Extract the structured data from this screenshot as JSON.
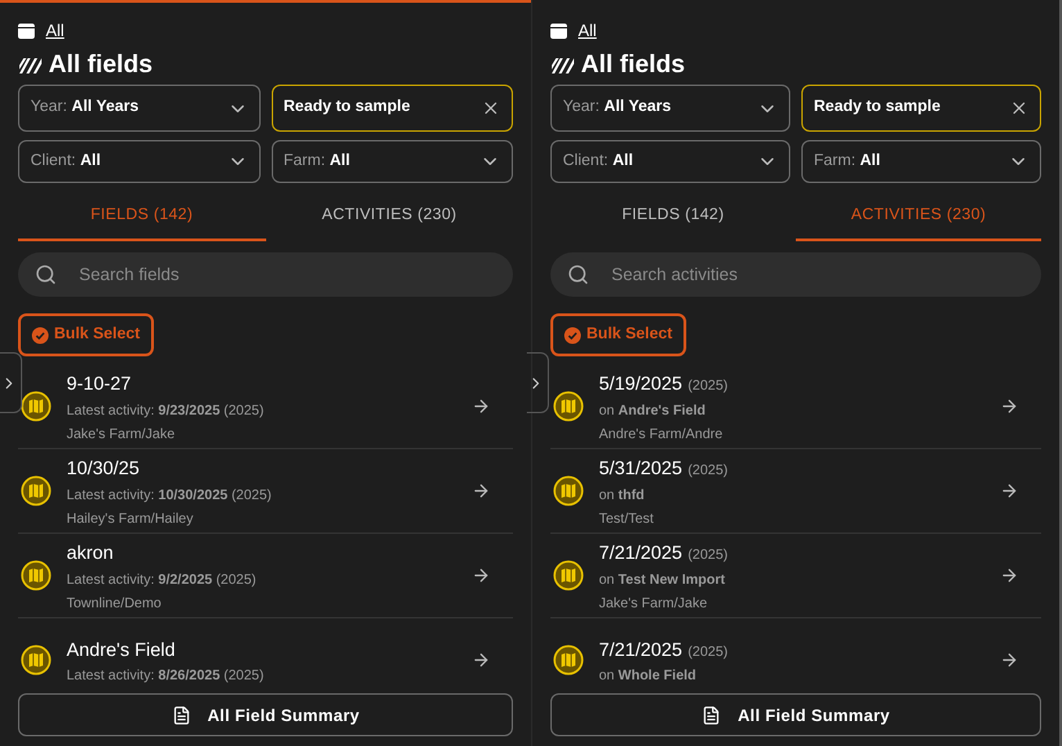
{
  "panels": [
    {
      "top_accent": true,
      "breadcrumb": "All",
      "title": "All fields",
      "filters": [
        {
          "kind": "select",
          "label": "Year:",
          "value": "All Years"
        },
        {
          "kind": "chip",
          "value": "Ready to sample"
        },
        {
          "kind": "select",
          "label": "Client:",
          "value": "All"
        },
        {
          "kind": "select",
          "label": "Farm:",
          "value": "All"
        }
      ],
      "tabs": [
        {
          "label": "FIELDS (142)",
          "selected": true
        },
        {
          "label": "ACTIVITIES (230)",
          "selected": false
        }
      ],
      "search": {
        "placeholder": "Search fields"
      },
      "bulk_select": "Bulk Select",
      "items": [
        {
          "title": "9-10-27",
          "detail": "Latest activity: **9/23/2025** (2025)",
          "location": "Jake's Farm/Jake"
        },
        {
          "title": "10/30/25",
          "detail": "Latest activity: **10/30/2025** (2025)",
          "location": "Hailey's Farm/Hailey"
        },
        {
          "title": "akron",
          "detail": "Latest activity: **9/2/2025** (2025)",
          "location": "Townline/Demo"
        },
        {
          "title": "Andre's Field",
          "detail": "Latest activity: **8/26/2025** (2025)"
        }
      ],
      "summary_button": "All Field Summary"
    },
    {
      "top_accent": false,
      "breadcrumb": "All",
      "title": "All fields",
      "filters": [
        {
          "kind": "select",
          "label": "Year:",
          "value": "All Years"
        },
        {
          "kind": "chip",
          "value": "Ready to sample"
        },
        {
          "kind": "select",
          "label": "Client:",
          "value": "All"
        },
        {
          "kind": "select",
          "label": "Farm:",
          "value": "All"
        }
      ],
      "tabs": [
        {
          "label": "FIELDS (142)",
          "selected": false
        },
        {
          "label": "ACTIVITIES (230)",
          "selected": true
        }
      ],
      "search": {
        "placeholder": "Search activities"
      },
      "bulk_select": "Bulk Select",
      "items": [
        {
          "title": "5/19/2025",
          "year": "(2025)",
          "detail": "on **Andre's Field**",
          "location": "Andre's Farm/Andre"
        },
        {
          "title": "5/31/2025",
          "year": "(2025)",
          "detail": "on **thfd**",
          "location": "Test/Test"
        },
        {
          "title": "7/21/2025",
          "year": "(2025)",
          "detail": "on **Test New Import**",
          "location": "Jake's Farm/Jake"
        },
        {
          "title": "7/21/2025",
          "year": "(2025)",
          "detail": "on **Whole Field**"
        }
      ],
      "summary_button": "All Field Summary"
    }
  ]
}
